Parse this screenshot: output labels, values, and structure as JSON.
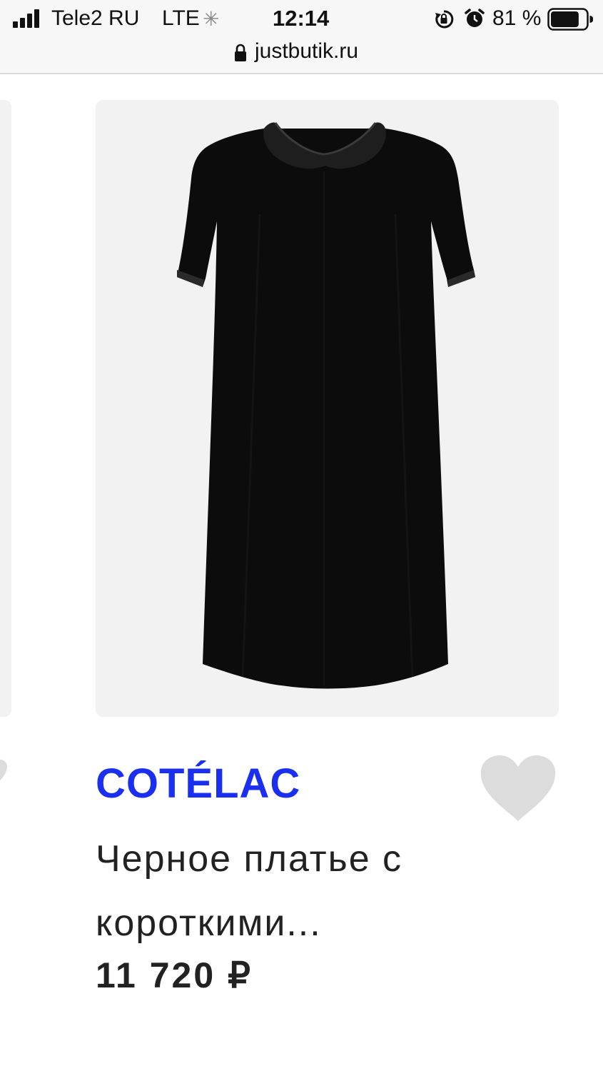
{
  "status_bar": {
    "carrier": "Tele2 RU",
    "network": "LTE",
    "time": "12:14",
    "battery": "81 %",
    "battery_level": 0.81
  },
  "url_bar": {
    "url": "justbutik.ru"
  },
  "product": {
    "brand": "COTÉLAC",
    "name_line1": "Черное платье с",
    "name_line2": "короткими...",
    "price": "11 720 ₽",
    "image_subject": "black-dress"
  },
  "colors": {
    "brand": "#1a2ff0",
    "heart": "#dcdcdc",
    "image_bg": "#f2f2f2"
  },
  "icons": {
    "signal": "cellular-signal-icon",
    "loading": "loading-spinner-icon",
    "rotation_lock": "rotation-lock-icon",
    "alarm": "alarm-clock-icon",
    "battery": "battery-icon",
    "lock": "lock-icon",
    "favorite": "heart-icon"
  }
}
